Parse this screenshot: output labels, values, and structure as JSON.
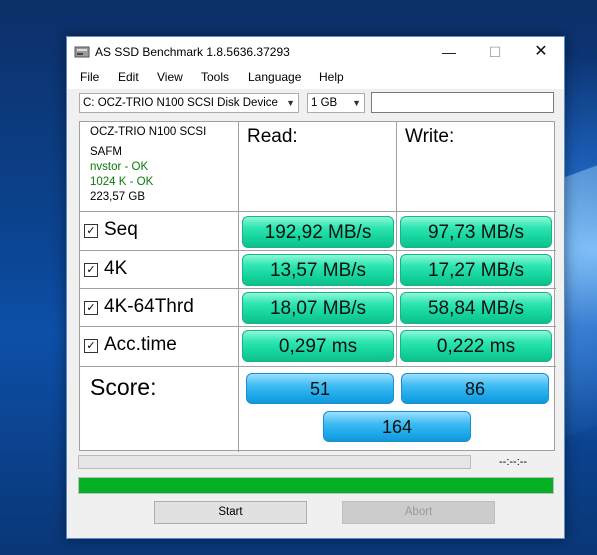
{
  "window": {
    "title": "AS SSD Benchmark 1.8.5636.37293",
    "controls": [
      "—",
      "☐",
      "✕"
    ]
  },
  "menu": [
    "File",
    "Edit",
    "View",
    "Tools",
    "Language",
    "Help"
  ],
  "drive_select": {
    "value": "C: OCZ-TRIO N100 SCSI Disk Device"
  },
  "size_select": {
    "value": "1 GB"
  },
  "info": {
    "model": "OCZ-TRIO N100 SCSI",
    "firmware": "SAFM",
    "driver": "nvstor - OK",
    "alignment": "1024 K - OK",
    "capacity": "223,57 GB"
  },
  "headers": {
    "read": "Read:",
    "write": "Write:"
  },
  "checkbox_mark": "☑",
  "rows": [
    {
      "label": "Seq",
      "read": "192,92 MB/s",
      "write": "97,73 MB/s"
    },
    {
      "label": "4K",
      "read": "13,57 MB/s",
      "write": "17,27 MB/s"
    },
    {
      "label": "4K-64Thrd",
      "read": "18,07 MB/s",
      "write": "58,84 MB/s"
    },
    {
      "label": "Acc.time",
      "read": "0,297 ms",
      "write": "0,222 ms"
    }
  ],
  "score": {
    "label": "Score:",
    "read": "51",
    "write": "86",
    "total": "164"
  },
  "progress": {
    "timer": "--:--:--",
    "overall_fraction": 1.0,
    "overall_color": "#06b025"
  },
  "buttons": {
    "start": "Start",
    "abort": "Abort"
  }
}
